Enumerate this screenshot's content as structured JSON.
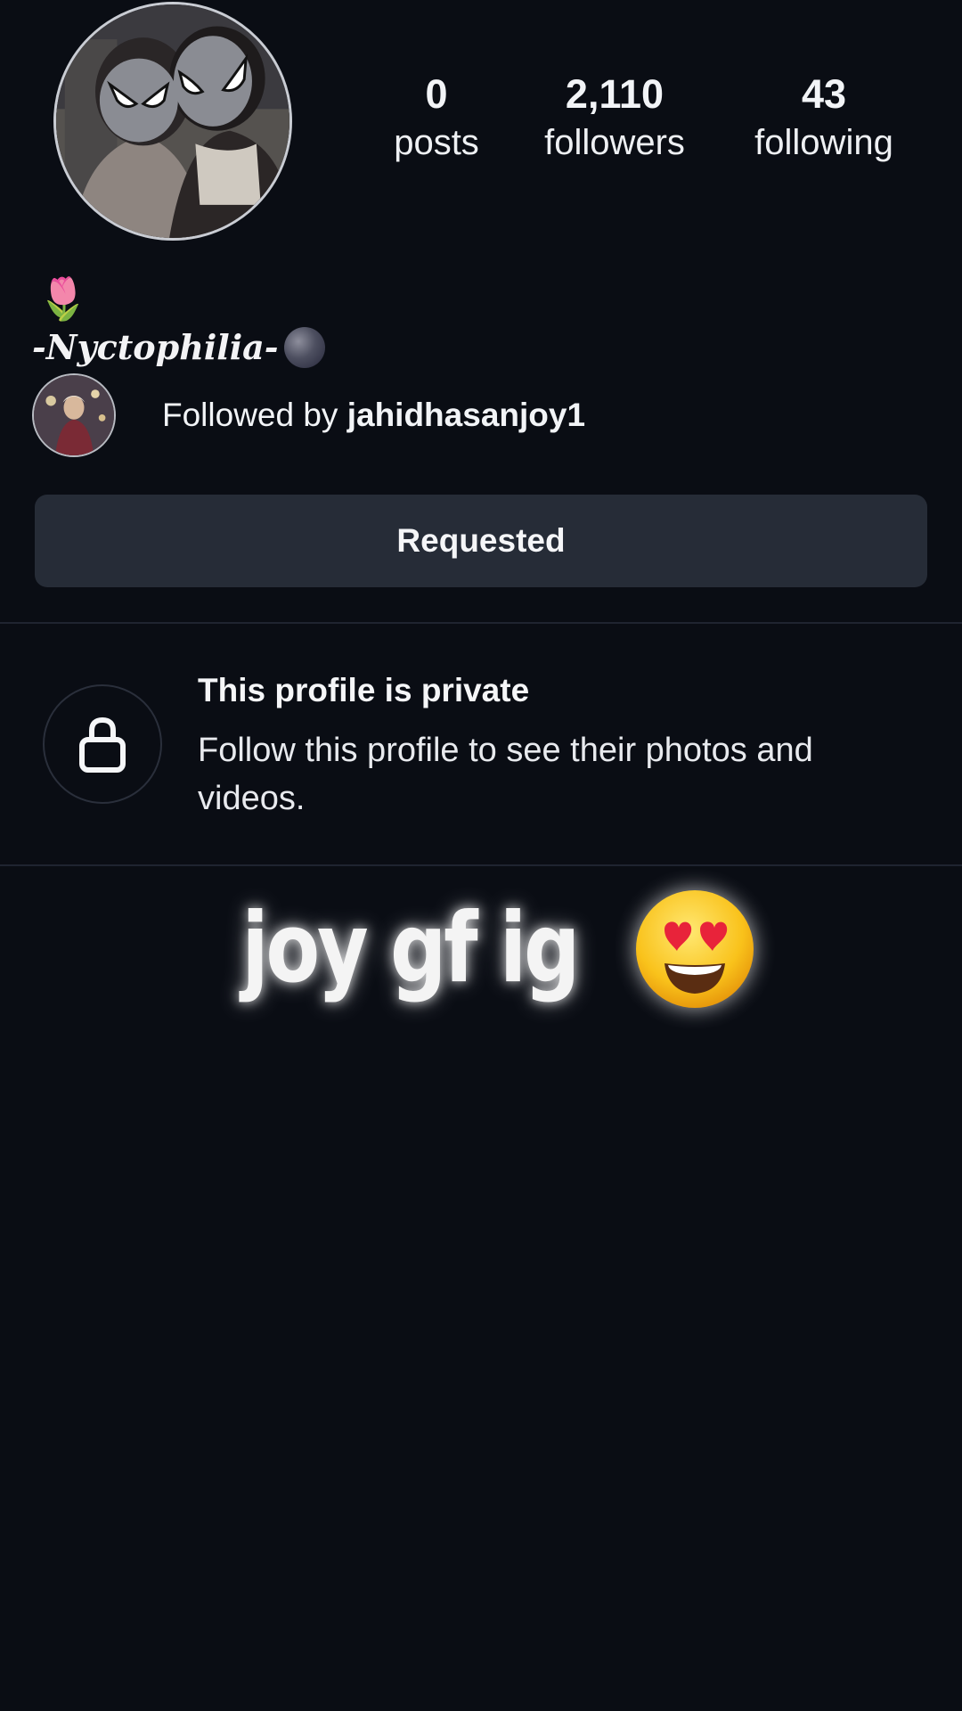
{
  "profile": {
    "stats": [
      {
        "value": "0",
        "label": "posts"
      },
      {
        "value": "2,110",
        "label": "followers"
      },
      {
        "value": "43",
        "label": "following"
      }
    ],
    "bio_emoji": "🌷",
    "display_name": "-Nyctophilia-",
    "followed_by_prefix": "Followed by ",
    "followed_by_user": "jahidhasanjoy1",
    "follow_button_label": "Requested"
  },
  "private_notice": {
    "title": "This profile is private",
    "description": "Follow this profile to see their photos and videos."
  },
  "overlay": {
    "caption": "joy gf ig"
  },
  "icons": {
    "lock": "lock-icon",
    "emoji": "heart-eyes-emoji"
  },
  "colors": {
    "background": "#0a0d14",
    "button": "#262c37",
    "divider": "#1f2430"
  }
}
